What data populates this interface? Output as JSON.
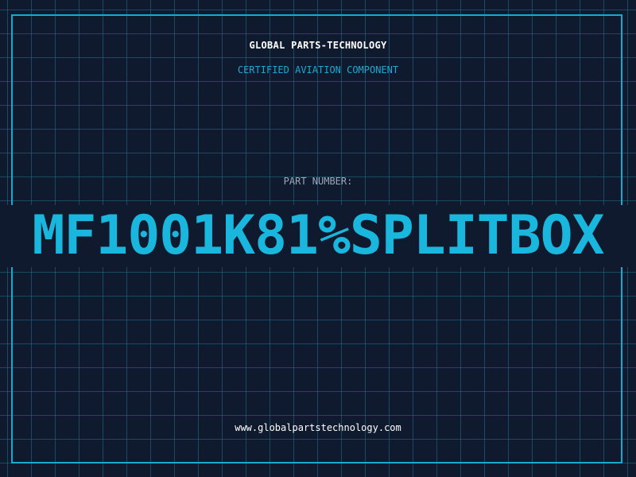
{
  "company_name": "GLOBAL PARTS-TECHNOLOGY",
  "subtitle": "CERTIFIED AVIATION COMPONENT",
  "part_label": "PART NUMBER:",
  "part_number": "MF1001K81%SPLITBOX",
  "website": "www.globalpartstechnology.com",
  "colors": {
    "background": "#101a2e",
    "grid": "#286e8c",
    "accent": "#19b6de",
    "frame": "#17a9cf",
    "label": "#9aa8ba",
    "text": "#ffffff"
  }
}
